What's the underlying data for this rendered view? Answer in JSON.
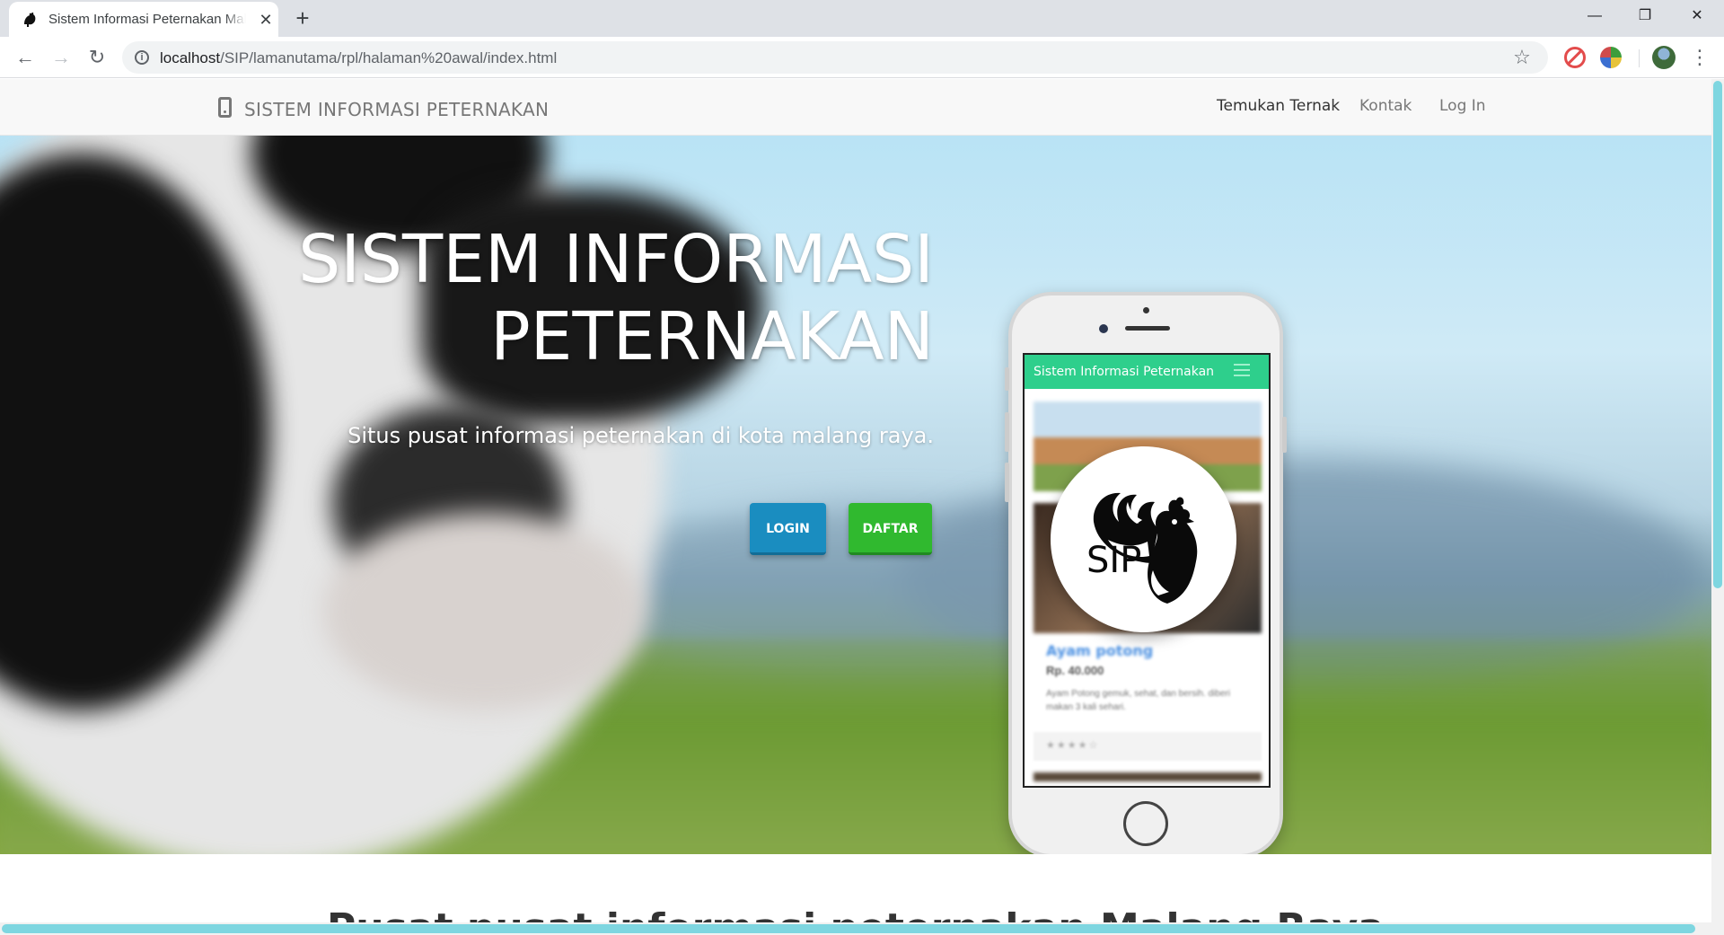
{
  "browser": {
    "tab_title": "Sistem Informasi Peternakan Malang",
    "tab_close": "✕",
    "new_tab": "+",
    "url_host": "localhost",
    "url_path": "/SIP/lamanutama/rpl/halaman%20awal/index.html",
    "back": "←",
    "forward": "→",
    "reload": "↻",
    "star": "☆",
    "menu": "⋮",
    "minimize": "—",
    "maximize": "❐",
    "close": "✕"
  },
  "site": {
    "brand": "SISTEM INFORMASI PETERNAKAN",
    "nav": [
      {
        "label": "Temukan Ternak"
      },
      {
        "label": "Kontak"
      },
      {
        "label": "Log In"
      }
    ]
  },
  "hero": {
    "title_line1": "SISTEM INFORMASI",
    "title_line2": "PETERNAKAN",
    "subtitle": "Situs pusat informasi peternakan di kota malang raya.",
    "login_label": "LOGIN",
    "daftar_label": "DAFTAR"
  },
  "phone": {
    "app_title": "Sistem Informasi Peternakan",
    "item_title": "Ayam potong",
    "item_price": "Rp. 40.000",
    "item_desc": "Ayam Potong gemuk, sehat, dan bersih. diberi makan 3 kali sehari.",
    "item_stars": "★★★★☆",
    "logo_text": "SIP"
  },
  "section": {
    "heading": "Pusat pusat informasi peternakan Malang Raya"
  },
  "colors": {
    "login_button": "#1a8dc0",
    "daftar_button": "#30b92f",
    "app_bar": "#2ecf8c",
    "scrollbar": "#7ed6e0"
  }
}
